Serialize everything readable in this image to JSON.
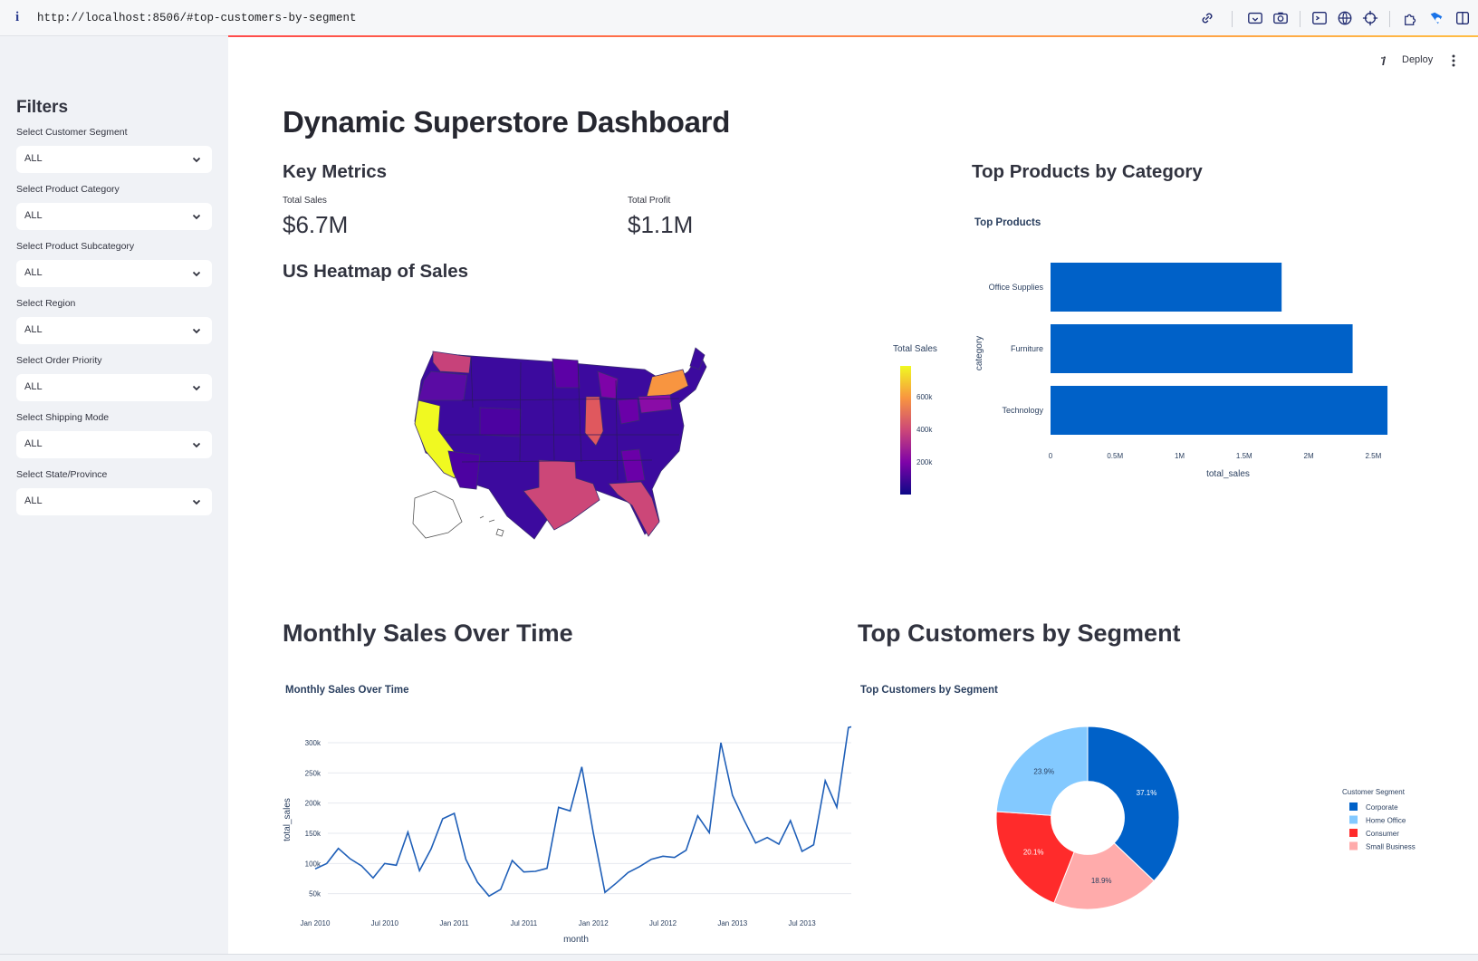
{
  "browser": {
    "info_glyph": "i",
    "url": "http://localhost:8506/#top-customers-by-segment"
  },
  "header": {
    "deploy_label": "Deploy"
  },
  "sidebar": {
    "title": "Filters",
    "filters": [
      {
        "label": "Select Customer Segment",
        "value": "ALL"
      },
      {
        "label": "Select Product Category",
        "value": "ALL"
      },
      {
        "label": "Select Product Subcategory",
        "value": "ALL"
      },
      {
        "label": "Select Region",
        "value": "ALL"
      },
      {
        "label": "Select Order Priority",
        "value": "ALL"
      },
      {
        "label": "Select Shipping Mode",
        "value": "ALL"
      },
      {
        "label": "Select State/Province",
        "value": "ALL"
      }
    ]
  },
  "main": {
    "title": "Dynamic Superstore Dashboard",
    "key_metrics_heading": "Key Metrics",
    "metrics": [
      {
        "label": "Total Sales",
        "value": "$6.7M"
      },
      {
        "label": "Total Profit",
        "value": "$1.1M"
      }
    ],
    "heatmap_heading": "US Heatmap of Sales",
    "top_products_heading": "Top Products by Category",
    "monthly_heading": "Monthly Sales Over Time",
    "customers_heading": "Top Customers by Segment"
  },
  "chart_data": [
    {
      "type": "heatmap",
      "title": "",
      "colorbar_title": "Total Sales",
      "colorbar_ticks": [
        "600k",
        "400k",
        "200k"
      ],
      "colorscale": [
        "#0d0887",
        "#7e03a8",
        "#cc4778",
        "#f89540",
        "#f0f921"
      ],
      "highlighted_states": {
        "California": "#f0f921",
        "New York": "#f89540",
        "Texas": "#cc4778",
        "Illinois": "#e0585e",
        "Florida": "#cc4778",
        "Washington": "#c7427a"
      }
    },
    {
      "type": "bar",
      "orientation": "horizontal",
      "title": "Top Products",
      "categories": [
        "Office Supplies",
        "Furniture",
        "Technology"
      ],
      "values": [
        1790000,
        2340000,
        2610000
      ],
      "xlabel": "total_sales",
      "ylabel": "category",
      "xticks": [
        "0",
        "0.5M",
        "1M",
        "1.5M",
        "2M",
        "2.5M"
      ],
      "xlim": [
        0,
        2750000
      ],
      "color": "#0061c8"
    },
    {
      "type": "line",
      "title": "Monthly Sales Over Time",
      "xlabel": "month",
      "ylabel": "total_sales",
      "xticks": [
        "Jan 2010",
        "Jul 2010",
        "Jan 2011",
        "Jul 2011",
        "Jan 2012",
        "Jul 2012",
        "Jan 2013",
        "Jul 2013"
      ],
      "yticks": [
        "50k",
        "100k",
        "150k",
        "200k",
        "250k",
        "300k"
      ],
      "ylim": [
        30000,
        330000
      ],
      "x_start": "2010-01",
      "x_end": "2013-12",
      "values": [
        91000,
        100000,
        125000,
        108000,
        96000,
        76000,
        100000,
        97000,
        152000,
        88000,
        124000,
        174000,
        183000,
        107000,
        69000,
        46000,
        57000,
        105000,
        86000,
        87000,
        92000,
        193000,
        187000,
        260000,
        150000,
        52000,
        68000,
        85000,
        95000,
        107000,
        112000,
        110000,
        122000,
        179000,
        151000,
        300000,
        213000,
        172000,
        134000,
        143000,
        132000,
        171000,
        120000,
        131000,
        237000,
        193000,
        325000,
        330000,
        227000
      ],
      "color": "#1f5fb8"
    },
    {
      "type": "pie",
      "title": "Top Customers by Segment",
      "legend_title": "Customer Segment",
      "labels": [
        "Corporate",
        "Home Office",
        "Consumer",
        "Small Business"
      ],
      "values": [
        37.1,
        23.9,
        20.1,
        18.9
      ],
      "colors": [
        "#0061c8",
        "#83c9ff",
        "#ff2b2b",
        "#ffabab"
      ],
      "hole": 0.4,
      "slice_order": [
        "Corporate",
        "Small Business",
        "Consumer",
        "Home Office"
      ]
    }
  ]
}
